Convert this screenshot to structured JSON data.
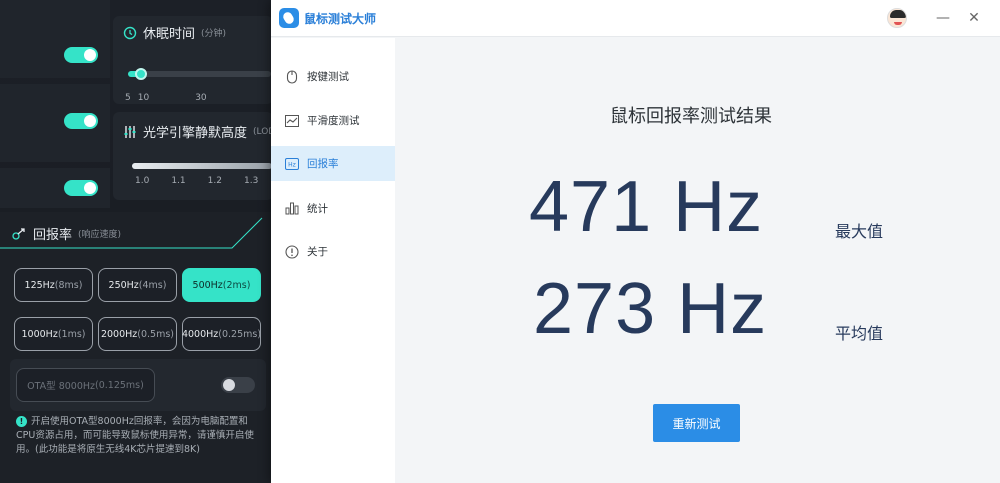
{
  "background_app": {
    "sleep_time": {
      "title": "休眠时间",
      "unit": "(分钟)",
      "ticks": [
        "5",
        "10",
        "30"
      ]
    },
    "lod": {
      "title": "光学引擎静默高度",
      "suffix": "(LOD",
      "ticks": [
        "1.0",
        "1.1",
        "1.2",
        "1.3"
      ]
    },
    "polling": {
      "title": "回报率",
      "subtitle": "(响应速度)",
      "options": [
        {
          "rate": "125Hz",
          "ms": "(8ms)"
        },
        {
          "rate": "250Hz",
          "ms": "(4ms)"
        },
        {
          "rate": "500Hz",
          "ms": "(2ms)"
        },
        {
          "rate": "1000Hz",
          "ms": "(1ms)"
        },
        {
          "rate": "2000Hz",
          "ms": "(0.5ms)"
        },
        {
          "rate": "4000Hz",
          "ms": "(0.25ms)"
        }
      ],
      "ota": {
        "rate": "OTA型 8000Hz",
        "ms": "(0.125ms)"
      },
      "note": "开启使用OTA型8000Hz回报率，会因为电脑配置和CPU资源占用，而可能导致鼠标使用异常，请谨慎开启使用。(此功能是将原生无线4K芯片提速到8K)"
    },
    "accent_color": "#35e3c8"
  },
  "window": {
    "title": "鼠标测试大师",
    "controls": {
      "minimize": "—",
      "close": "✕"
    },
    "nav": [
      {
        "label": "按键测试",
        "icon": "mouse-icon"
      },
      {
        "label": "平滑度测试",
        "icon": "trend-icon"
      },
      {
        "label": "回报率",
        "icon": "hz-icon"
      },
      {
        "label": "统计",
        "icon": "bar-chart-icon"
      },
      {
        "label": "关于",
        "icon": "info-icon"
      }
    ],
    "active_nav": "回报率",
    "result": {
      "title": "鼠标回报率测试结果",
      "max_value": "471 Hz",
      "max_label": "最大值",
      "avg_value": "273 Hz",
      "avg_label": "平均值",
      "retest_label": "重新测试"
    },
    "accent_color": "#2b8de6"
  }
}
